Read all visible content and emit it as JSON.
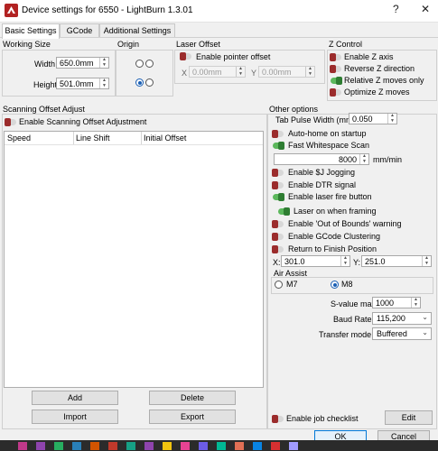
{
  "window": {
    "title": "Device settings for 6550 - LightBurn 1.3.01",
    "help": "?",
    "close": "✕"
  },
  "tabs": [
    {
      "label": "Basic Settings"
    },
    {
      "label": "GCode"
    },
    {
      "label": "Additional Settings"
    }
  ],
  "working_size": {
    "title": "Working Size",
    "width_label": "Width",
    "width_value": "650.0mm",
    "height_label": "Height",
    "height_value": "501.0mm"
  },
  "origin": {
    "title": "Origin",
    "selected": "bottom-left"
  },
  "laser_offset": {
    "title": "Laser Offset",
    "enable_label": "Enable pointer offset",
    "enabled": false,
    "x_label": "X",
    "x_value": "0.00mm",
    "y_label": "Y",
    "y_value": "0.00mm"
  },
  "z_control": {
    "title": "Z Control",
    "items": [
      {
        "label": "Enable Z axis",
        "on": false
      },
      {
        "label": "Reverse Z direction",
        "on": false
      },
      {
        "label": "Relative Z moves only",
        "on": true
      },
      {
        "label": "Optimize Z moves",
        "on": false
      }
    ]
  },
  "scanning": {
    "title": "Scanning Offset Adjust",
    "enable_label": "Enable Scanning Offset Adjustment",
    "enabled": false,
    "columns": [
      "Speed",
      "Line Shift",
      "Initial Offset"
    ],
    "buttons": {
      "add": "Add",
      "delete": "Delete",
      "import": "Import",
      "export": "Export"
    }
  },
  "other": {
    "title": "Other options",
    "tab_pulse_label": "Tab Pulse Width (mm)",
    "tab_pulse_value": "0.050",
    "auto_home": {
      "label": "Auto-home on startup",
      "on": false
    },
    "fast_ws": {
      "label": "Fast Whitespace Scan",
      "on": true
    },
    "ws_value": "8000",
    "ws_unit": "mm/min",
    "toggles": [
      {
        "label": "Enable $J Jogging",
        "on": false
      },
      {
        "label": "Enable DTR signal",
        "on": false
      },
      {
        "label": "Enable laser fire button",
        "on": true
      },
      {
        "label": "Laser on when framing",
        "on": true
      },
      {
        "label": "Enable 'Out of Bounds' warning",
        "on": false
      },
      {
        "label": "Enable GCode Clustering",
        "on": false
      },
      {
        "label": "Return to Finish Position",
        "on": false
      }
    ],
    "x_label": "X:",
    "x_value": "301.0",
    "y_label": "Y:",
    "y_value": "251.0",
    "air_assist": {
      "title": "Air Assist",
      "m7": "M7",
      "m8": "M8",
      "selected": "M8"
    },
    "svalue_label": "S-value max",
    "svalue_value": "1000",
    "baud_label": "Baud Rate",
    "baud_value": "115,200",
    "transfer_label": "Transfer mode",
    "transfer_value": "Buffered",
    "job_checklist": {
      "label": "Enable job checklist",
      "on": false
    },
    "edit_label": "Edit"
  },
  "footer": {
    "ok": "OK",
    "cancel": "Cancel"
  },
  "colors": {
    "toggle_on": "#2e7d32",
    "toggle_off": "#9b2c2c",
    "accent": "#0078d7"
  }
}
